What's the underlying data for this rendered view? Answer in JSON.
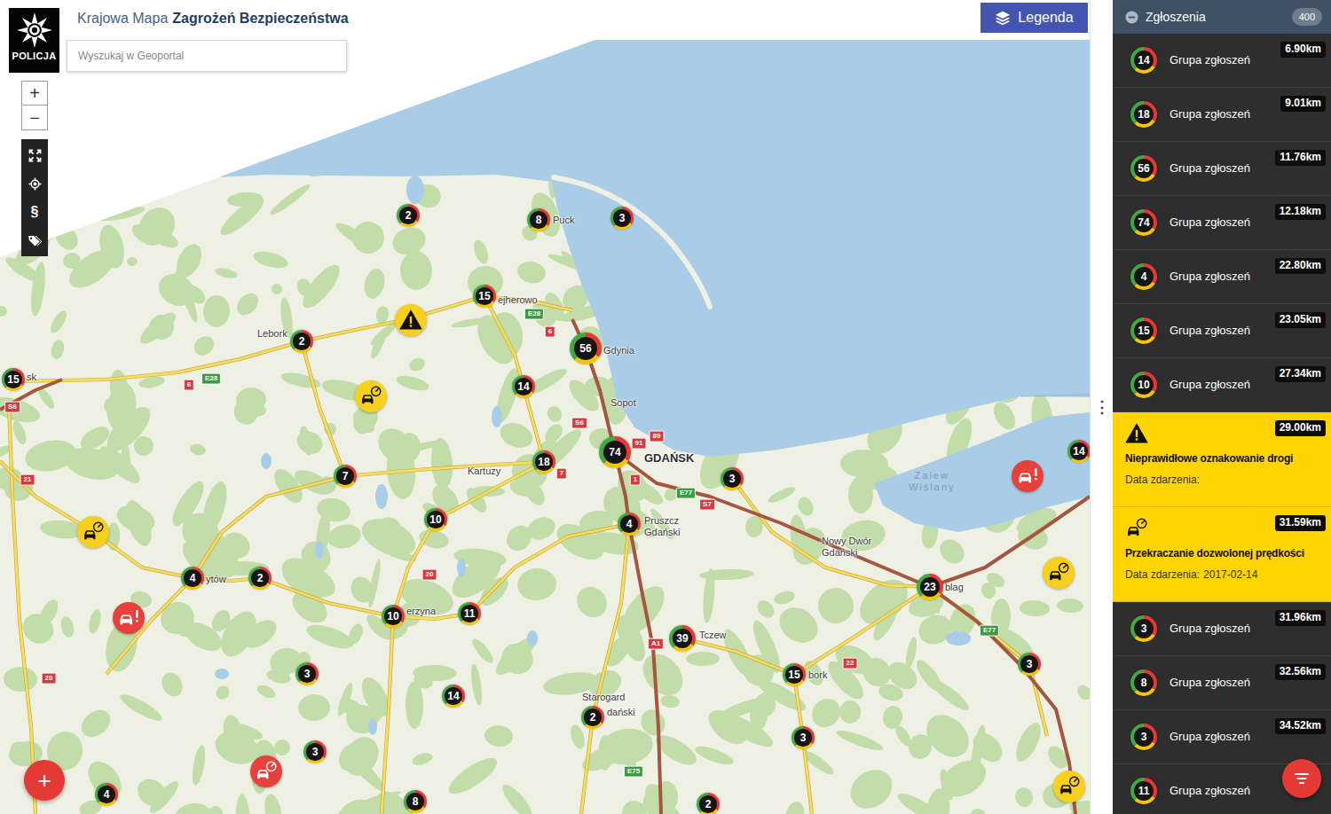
{
  "header": {
    "logo_text": "POLICJA",
    "title_light": "Krajowa Mapa",
    "title_strong": "Zagrożeń Bezpieczeństwa",
    "search": {
      "placeholder": "Wyszukaj w Geoportal"
    },
    "legend_button": "Legenda"
  },
  "map_controls": {
    "zoom_in": "+",
    "zoom_out": "−",
    "tools": [
      {
        "kind": "fullscreen"
      },
      {
        "kind": "locate"
      },
      {
        "kind": "law",
        "label": "§"
      },
      {
        "kind": "tags"
      }
    ],
    "add_button": "+",
    "panel_menu": "⋮"
  },
  "map": {
    "places": [
      {
        "kind": "town",
        "lines": [
          "Puck"
        ]
      },
      {
        "kind": "town",
        "lines": [
          "ejherowo"
        ]
      },
      {
        "kind": "town",
        "lines": [
          "Lebork"
        ]
      },
      {
        "kind": "town",
        "lines": [
          "sk"
        ]
      },
      {
        "kind": "town",
        "lines": [
          "Gdynia"
        ]
      },
      {
        "kind": "town",
        "lines": [
          "Sopot"
        ]
      },
      {
        "kind": "capital",
        "lines": [
          "GDAŃSK"
        ]
      },
      {
        "kind": "town",
        "lines": [
          "Kartuzy"
        ]
      },
      {
        "kind": "town",
        "lines": [
          "Pruszcz",
          "Gdański"
        ]
      },
      {
        "kind": "town",
        "lines": [
          "Nowy Dwór",
          "Gdański"
        ]
      },
      {
        "kind": "water",
        "lines": [
          "Zalew",
          "Wiślany"
        ]
      },
      {
        "kind": "town",
        "lines": [
          "ytów"
        ]
      },
      {
        "kind": "town",
        "lines": [
          "erzyna"
        ]
      },
      {
        "kind": "town",
        "lines": [
          "blag"
        ]
      },
      {
        "kind": "town",
        "lines": [
          "Tczew"
        ]
      },
      {
        "kind": "town",
        "lines": [
          "Starogard"
        ]
      },
      {
        "kind": "town",
        "lines": [
          "dański"
        ]
      },
      {
        "kind": "town",
        "lines": [
          "bork"
        ]
      }
    ],
    "shields": [
      {
        "text": "E28",
        "kind": "e-road"
      },
      {
        "text": "6",
        "kind": "national"
      },
      {
        "text": "E28",
        "kind": "e-road"
      },
      {
        "text": "6",
        "kind": "national"
      },
      {
        "text": "S6",
        "kind": "national"
      },
      {
        "text": "21",
        "kind": "national"
      },
      {
        "text": "S6",
        "kind": "national"
      },
      {
        "text": "91",
        "kind": "national"
      },
      {
        "text": "89",
        "kind": "national"
      },
      {
        "text": "7",
        "kind": "national"
      },
      {
        "text": "1",
        "kind": "national"
      },
      {
        "text": "E77",
        "kind": "e-road"
      },
      {
        "text": "S7",
        "kind": "national"
      },
      {
        "text": "20",
        "kind": "national"
      },
      {
        "text": "20",
        "kind": "national"
      },
      {
        "text": "A1",
        "kind": "national"
      },
      {
        "text": "22",
        "kind": "national"
      },
      {
        "text": "E77",
        "kind": "e-road"
      },
      {
        "text": "E75",
        "kind": "e-road"
      }
    ],
    "markers": [
      {
        "kind": "cluster",
        "count": "2"
      },
      {
        "kind": "cluster",
        "count": "8"
      },
      {
        "kind": "cluster",
        "count": "3"
      },
      {
        "kind": "cluster",
        "count": "15"
      },
      {
        "kind": "cluster",
        "count": "2"
      },
      {
        "kind": "cluster",
        "count": "56"
      },
      {
        "kind": "cluster",
        "count": "15"
      },
      {
        "kind": "cluster",
        "count": "14"
      },
      {
        "kind": "cluster",
        "count": "74"
      },
      {
        "kind": "cluster",
        "count": "18"
      },
      {
        "kind": "cluster",
        "count": "7"
      },
      {
        "kind": "cluster",
        "count": "3"
      },
      {
        "kind": "cluster",
        "count": "14"
      },
      {
        "kind": "cluster",
        "count": "10"
      },
      {
        "kind": "cluster",
        "count": "4"
      },
      {
        "kind": "cluster",
        "count": "4"
      },
      {
        "kind": "cluster",
        "count": "2"
      },
      {
        "kind": "cluster",
        "count": "10"
      },
      {
        "kind": "cluster",
        "count": "11"
      },
      {
        "kind": "cluster",
        "count": "23"
      },
      {
        "kind": "cluster",
        "count": "39"
      },
      {
        "kind": "cluster",
        "count": "3"
      },
      {
        "kind": "cluster",
        "count": "3"
      },
      {
        "kind": "cluster",
        "count": "14"
      },
      {
        "kind": "cluster",
        "count": "15"
      },
      {
        "kind": "cluster",
        "count": "2"
      },
      {
        "kind": "cluster",
        "count": "3"
      },
      {
        "kind": "cluster",
        "count": "3"
      },
      {
        "kind": "cluster",
        "count": "4"
      },
      {
        "kind": "cluster",
        "count": "8"
      },
      {
        "kind": "cluster",
        "count": "2"
      },
      {
        "kind": "warning",
        "color": "#f7cf1d"
      },
      {
        "kind": "speeding",
        "color": "#f7cf1d"
      },
      {
        "kind": "speeding",
        "color": "#f7cf1d"
      },
      {
        "kind": "speeding",
        "color": "#f7cf1d"
      },
      {
        "kind": "speeding",
        "color": "#f7cf1d"
      },
      {
        "kind": "accident",
        "color": "#e8413b"
      },
      {
        "kind": "accident",
        "color": "#e8413b"
      },
      {
        "kind": "speeding",
        "color": "#e8413b"
      }
    ]
  },
  "sidebar": {
    "title": "Zgłoszenia",
    "count": "400",
    "items": [
      {
        "kind": "group",
        "count": "14",
        "label": "Grupa zgłoszeń",
        "distance": "6.90km"
      },
      {
        "kind": "group",
        "count": "18",
        "label": "Grupa zgłoszeń",
        "distance": "9.01km"
      },
      {
        "kind": "group",
        "count": "56",
        "label": "Grupa zgłoszeń",
        "distance": "11.76km"
      },
      {
        "kind": "group",
        "count": "74",
        "label": "Grupa zgłoszeń",
        "distance": "12.18km"
      },
      {
        "kind": "group",
        "count": "4",
        "label": "Grupa zgłoszeń",
        "distance": "22.80km"
      },
      {
        "kind": "group",
        "count": "15",
        "label": "Grupa zgłoszeń",
        "distance": "23.05km"
      },
      {
        "kind": "group",
        "count": "10",
        "label": "Grupa zgłoszeń",
        "distance": "27.34km"
      },
      {
        "kind": "warning",
        "title": "Nieprawidłowe oznakowanie drogi",
        "date_label": "Data zdarzenia:",
        "distance": "29.00km"
      },
      {
        "kind": "speeding",
        "title": "Przekraczanie dozwolonej prędkości",
        "date_label": "Data zdarzenia:",
        "date": "2017-02-14",
        "distance": "31.59km"
      },
      {
        "kind": "group",
        "count": "3",
        "label": "Grupa zgłoszeń",
        "distance": "31.96km"
      },
      {
        "kind": "group",
        "count": "8",
        "label": "Grupa zgłoszeń",
        "distance": "32.56km"
      },
      {
        "kind": "group",
        "count": "3",
        "label": "Grupa zgłoszeń",
        "distance": "34.52km"
      },
      {
        "kind": "group",
        "count": "11",
        "label": "Grupa zgłoszeń"
      }
    ]
  }
}
